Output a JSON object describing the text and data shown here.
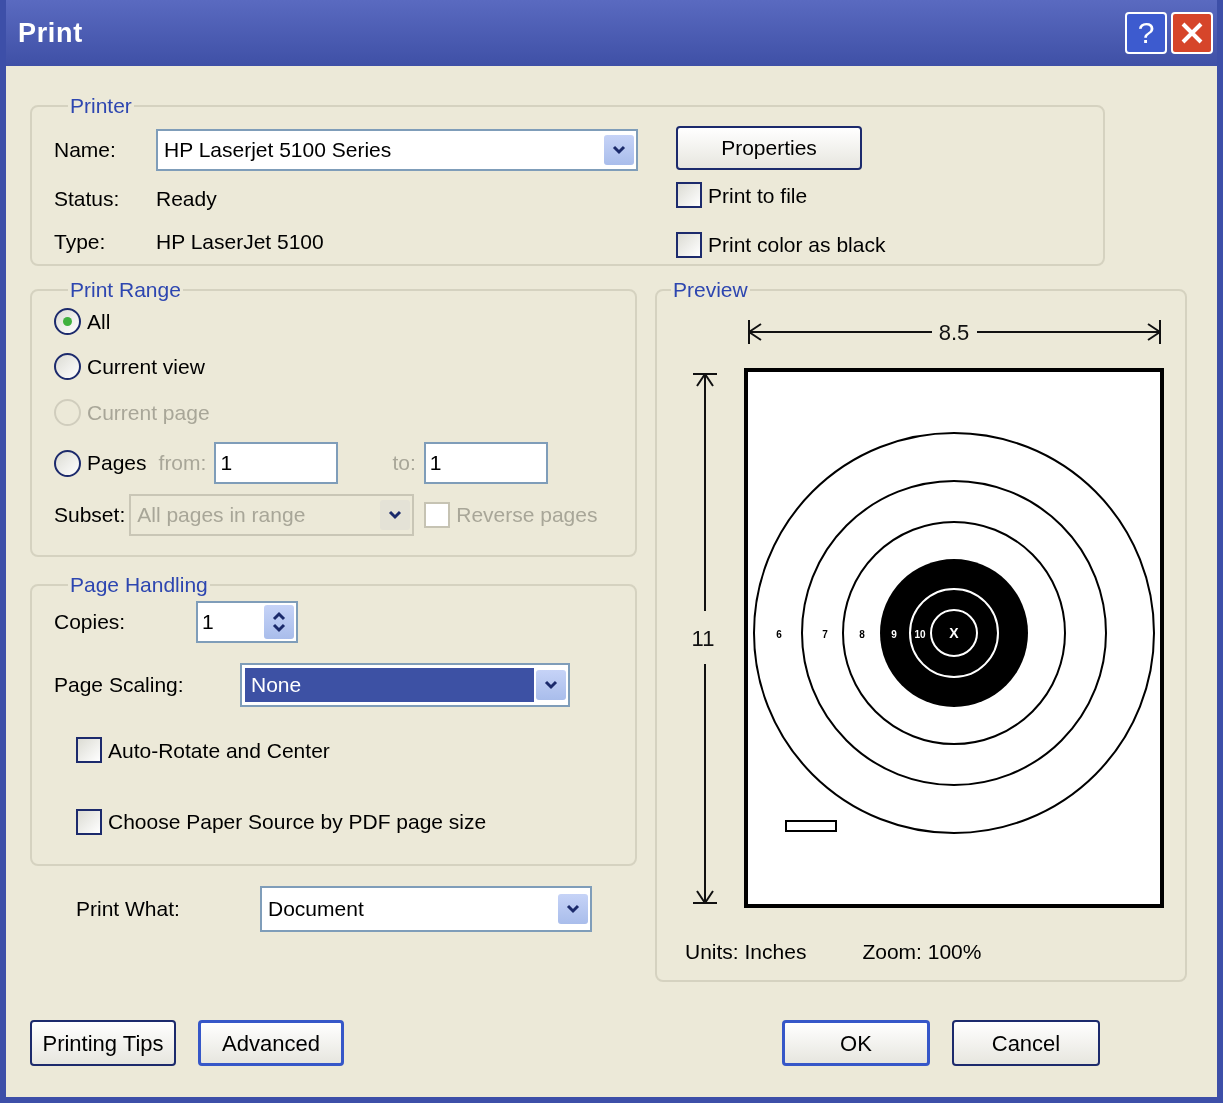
{
  "window": {
    "title": "Print",
    "controls": [
      {
        "kind": "help",
        "label": "?"
      },
      {
        "kind": "close"
      }
    ]
  },
  "printer": {
    "legend": "Printer",
    "name_label": "Name:",
    "name_value": "HP Laserjet 5100 Series",
    "status_label": "Status:",
    "status_value": "Ready",
    "type_label": "Type:",
    "type_value": "HP LaserJet 5100",
    "properties_button": "Properties",
    "checkboxes": [
      {
        "label": "Print to file",
        "checked": false
      },
      {
        "label": "Print color as black",
        "checked": false
      }
    ]
  },
  "print_range": {
    "legend": "Print Range",
    "options": [
      {
        "label": "All",
        "selected": true,
        "disabled": false
      },
      {
        "label": "Current view",
        "selected": false,
        "disabled": false
      },
      {
        "label": "Current page",
        "selected": false,
        "disabled": true
      },
      {
        "label": "Pages",
        "selected": false,
        "disabled": false
      }
    ],
    "from_label": "from:",
    "from_value": "1",
    "to_label": "to:",
    "to_value": "1",
    "subset_label": "Subset:",
    "subset_value": "All pages in range",
    "subset_disabled": true,
    "reverse": {
      "label": "Reverse pages",
      "checked": false,
      "disabled": true
    }
  },
  "page_handling": {
    "legend": "Page Handling",
    "copies_label": "Copies:",
    "copies_value": "1",
    "scaling_label": "Page Scaling:",
    "scaling_value": "None",
    "scaling_selected": true,
    "checkboxes": [
      {
        "label": "Auto-Rotate and Center",
        "checked": false
      },
      {
        "label": "Choose Paper Source by PDF page size",
        "checked": false
      }
    ]
  },
  "print_what": {
    "label": "Print What:",
    "value": "Document"
  },
  "preview": {
    "legend": "Preview",
    "width_label": "8.5",
    "height_label": "11",
    "ring_labels": [
      "6",
      "7",
      "8",
      "9",
      "10",
      "X"
    ],
    "units": "Units: Inches",
    "zoom": "Zoom: 100%"
  },
  "footer": {
    "left_buttons": [
      {
        "label": "Printing Tips",
        "default": false
      },
      {
        "label": "Advanced",
        "default": true
      }
    ],
    "right_buttons": [
      {
        "label": "OK",
        "default": true
      },
      {
        "label": "Cancel",
        "default": false
      }
    ]
  }
}
